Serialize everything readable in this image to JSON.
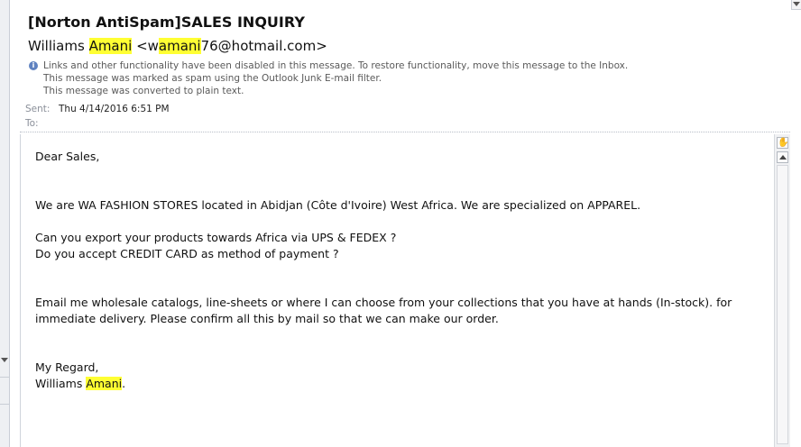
{
  "message": {
    "subject": "[Norton AntiSpam]SALES INQUIRY",
    "from": {
      "name_first": "Williams ",
      "name_highlight": "Amani",
      "email_open": " <w",
      "email_highlight": "amani",
      "email_rest": "76@hotmail.com>"
    },
    "infobar": [
      "Links and other functionality have been disabled in this message. To restore functionality, move this message to the Inbox.",
      "This message was marked as spam using the Outlook Junk E-mail filter.",
      "This message was converted to plain text."
    ],
    "sent_label": "Sent:",
    "sent_value": "Thu 4/14/2016 6:51 PM",
    "to_label": "To:",
    "to_value": ""
  },
  "body": {
    "greeting": "Dear Sales,",
    "para1": "We are WA FASHION STORES located in Abidjan (Côte d'Ivoire) West Africa. We are specialized on APPAREL.",
    "para2_line1": "Can you export your products towards Africa via UPS & FEDEX ?",
    "para2_line2": "Do you accept CREDIT CARD as method of payment ?",
    "para3_line1": "Email me wholesale catalogs, line-sheets or where I can choose from your collections that you have at hands (In-stock). for",
    "para3_line2": "immediate delivery. Please confirm all this by mail so that we can make our order.",
    "closing": "My Regard,",
    "signature_first": "Williams ",
    "signature_highlight": "Amani",
    "signature_end": "."
  },
  "icons": {
    "info": "info-icon",
    "hand": "hand-icon",
    "scroll_up": "chevron-up-icon",
    "collapse": "chevron-down-icon"
  },
  "colors": {
    "highlight": "#ffff33",
    "info_icon": "#5f82c0",
    "meta_label": "#8a8f99"
  }
}
